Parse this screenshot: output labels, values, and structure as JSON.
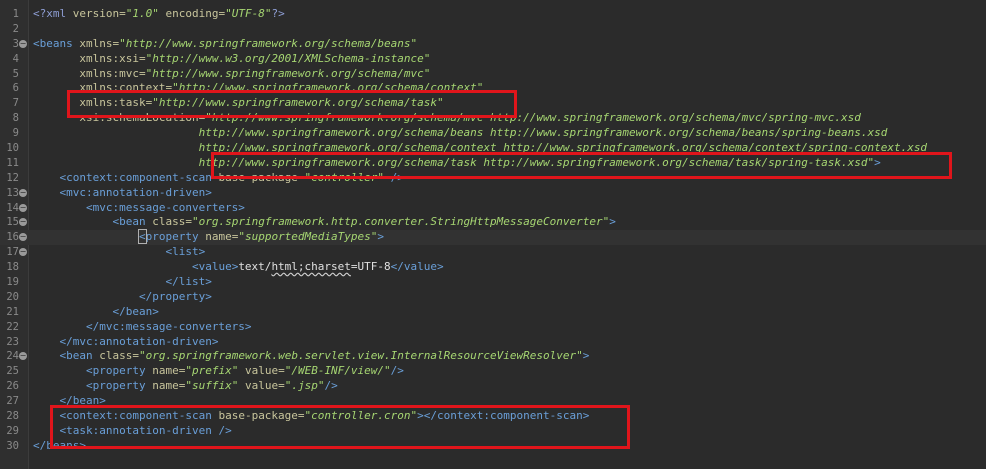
{
  "editor": {
    "highlight_color": "#e0151b",
    "lines": [
      {
        "n": "1",
        "fold": false,
        "indent": 0,
        "tokens": [
          {
            "t": "pi",
            "v": "<?xml "
          },
          {
            "t": "attr",
            "v": "version="
          },
          {
            "t": "val",
            "v": "\"1.0\""
          },
          {
            "t": "plain",
            "v": " "
          },
          {
            "t": "attr",
            "v": "encoding="
          },
          {
            "t": "val",
            "v": "\"UTF-8\""
          },
          {
            "t": "pi",
            "v": "?>"
          }
        ]
      },
      {
        "n": "2",
        "fold": false,
        "indent": 0,
        "tokens": []
      },
      {
        "n": "3",
        "fold": true,
        "indent": 0,
        "tokens": [
          {
            "t": "tag",
            "v": "<beans"
          },
          {
            "t": "plain",
            "v": " "
          },
          {
            "t": "attr",
            "v": "xmlns="
          },
          {
            "t": "val",
            "v": "\"http://www.springframework.org/schema/beans\""
          }
        ]
      },
      {
        "n": "4",
        "fold": false,
        "indent": 0,
        "tokens": [
          {
            "t": "plain",
            "v": "       "
          },
          {
            "t": "attr",
            "v": "xmlns:xsi="
          },
          {
            "t": "val",
            "v": "\"http://www.w3.org/2001/XMLSchema-instance\""
          }
        ]
      },
      {
        "n": "5",
        "fold": false,
        "indent": 0,
        "tokens": [
          {
            "t": "plain",
            "v": "       "
          },
          {
            "t": "attr",
            "v": "xmlns:mvc="
          },
          {
            "t": "val",
            "v": "\"http://www.springframework.org/schema/mvc\""
          }
        ]
      },
      {
        "n": "6",
        "fold": false,
        "indent": 0,
        "tokens": [
          {
            "t": "plain",
            "v": "       "
          },
          {
            "t": "attr",
            "v": "xmlns:context="
          },
          {
            "t": "val",
            "v": "\"http://www.springframework.org/schema/context\""
          }
        ]
      },
      {
        "n": "7",
        "fold": false,
        "indent": 0,
        "tokens": [
          {
            "t": "plain",
            "v": "       "
          },
          {
            "t": "attr",
            "v": "xmlns:task="
          },
          {
            "t": "val",
            "v": "\"http://www.springframework.org/schema/task\""
          }
        ]
      },
      {
        "n": "8",
        "fold": false,
        "indent": 0,
        "tokens": [
          {
            "t": "plain",
            "v": "       "
          },
          {
            "t": "attr",
            "v": "xsi:schemaLocation="
          },
          {
            "t": "val",
            "v": "\"http://www.springframework.org/schema/mvc http://www.springframework.org/schema/mvc/spring-mvc.xsd"
          }
        ]
      },
      {
        "n": "9",
        "fold": false,
        "indent": 0,
        "tokens": [
          {
            "t": "plain",
            "v": "                         "
          },
          {
            "t": "val",
            "v": "http://www.springframework.org/schema/beans http://www.springframework.org/schema/beans/spring-beans.xsd"
          }
        ]
      },
      {
        "n": "10",
        "fold": false,
        "indent": 0,
        "tokens": [
          {
            "t": "plain",
            "v": "                         "
          },
          {
            "t": "val",
            "v": "http://www.springframework.org/schema/context http://www.springframework.org/schema/context/spring-context.xsd"
          }
        ]
      },
      {
        "n": "11",
        "fold": false,
        "indent": 0,
        "tokens": [
          {
            "t": "plain",
            "v": "                         "
          },
          {
            "t": "val",
            "v": "http://www.springframework.org/schema/task http://www.springframework.org/schema/task/spring-task.xsd\""
          },
          {
            "t": "tag",
            "v": ">"
          }
        ]
      },
      {
        "n": "12",
        "fold": false,
        "indent": 0,
        "tokens": [
          {
            "t": "plain",
            "v": "    "
          },
          {
            "t": "tag",
            "v": "<context:component-scan"
          },
          {
            "t": "plain",
            "v": " "
          },
          {
            "t": "attr",
            "v": "base-package="
          },
          {
            "t": "val",
            "v": "\"controller\""
          },
          {
            "t": "tag",
            "v": " />"
          }
        ]
      },
      {
        "n": "13",
        "fold": true,
        "indent": 0,
        "tokens": [
          {
            "t": "plain",
            "v": "    "
          },
          {
            "t": "tag",
            "v": "<mvc:annotation-driven>"
          }
        ]
      },
      {
        "n": "14",
        "fold": true,
        "indent": 0,
        "tokens": [
          {
            "t": "plain",
            "v": "        "
          },
          {
            "t": "tag",
            "v": "<mvc:message-converters>"
          }
        ]
      },
      {
        "n": "15",
        "fold": true,
        "indent": 0,
        "tokens": [
          {
            "t": "plain",
            "v": "            "
          },
          {
            "t": "tag",
            "v": "<bean"
          },
          {
            "t": "plain",
            "v": " "
          },
          {
            "t": "attr",
            "v": "class="
          },
          {
            "t": "val",
            "v": "\"org.springframework.http.converter.StringHttpMessageConverter\""
          },
          {
            "t": "tag",
            "v": ">"
          }
        ]
      },
      {
        "n": "16",
        "fold": true,
        "indent": 0,
        "current": true,
        "tokens": [
          {
            "t": "plain",
            "v": "                "
          },
          {
            "t": "tagbox",
            "v": "<"
          },
          {
            "t": "tag",
            "v": "property"
          },
          {
            "t": "plain",
            "v": " "
          },
          {
            "t": "attr",
            "v": "name="
          },
          {
            "t": "val",
            "v": "\"supportedMediaTypes\""
          },
          {
            "t": "tag",
            "v": ">"
          }
        ]
      },
      {
        "n": "17",
        "fold": true,
        "indent": 0,
        "tokens": [
          {
            "t": "plain",
            "v": "                    "
          },
          {
            "t": "tag",
            "v": "<list>"
          }
        ]
      },
      {
        "n": "18",
        "fold": false,
        "indent": 0,
        "tokens": [
          {
            "t": "plain",
            "v": "                        "
          },
          {
            "t": "tag",
            "v": "<value>"
          },
          {
            "t": "text",
            "v": "text/"
          },
          {
            "t": "err",
            "v": "html;charset"
          },
          {
            "t": "text",
            "v": "=UTF-8"
          },
          {
            "t": "tag",
            "v": "</value>"
          }
        ]
      },
      {
        "n": "19",
        "fold": false,
        "indent": 0,
        "tokens": [
          {
            "t": "plain",
            "v": "                    "
          },
          {
            "t": "tag",
            "v": "</list>"
          }
        ]
      },
      {
        "n": "20",
        "fold": false,
        "indent": 0,
        "tokens": [
          {
            "t": "plain",
            "v": "                "
          },
          {
            "t": "tag",
            "v": "</property>"
          }
        ]
      },
      {
        "n": "21",
        "fold": false,
        "indent": 0,
        "tokens": [
          {
            "t": "plain",
            "v": "            "
          },
          {
            "t": "tag",
            "v": "</bean>"
          }
        ]
      },
      {
        "n": "22",
        "fold": false,
        "indent": 0,
        "tokens": [
          {
            "t": "plain",
            "v": "        "
          },
          {
            "t": "tag",
            "v": "</mvc:message-converters>"
          }
        ]
      },
      {
        "n": "23",
        "fold": false,
        "indent": 0,
        "tokens": [
          {
            "t": "plain",
            "v": "    "
          },
          {
            "t": "tag",
            "v": "</mvc:annotation-driven>"
          }
        ]
      },
      {
        "n": "24",
        "fold": true,
        "indent": 0,
        "tokens": [
          {
            "t": "plain",
            "v": "    "
          },
          {
            "t": "tag",
            "v": "<bean"
          },
          {
            "t": "plain",
            "v": " "
          },
          {
            "t": "attr",
            "v": "class="
          },
          {
            "t": "val",
            "v": "\"org.springframework.web.servlet.view.InternalResourceViewResolver\""
          },
          {
            "t": "tag",
            "v": ">"
          }
        ]
      },
      {
        "n": "25",
        "fold": false,
        "indent": 0,
        "tokens": [
          {
            "t": "plain",
            "v": "        "
          },
          {
            "t": "tag",
            "v": "<property"
          },
          {
            "t": "plain",
            "v": " "
          },
          {
            "t": "attr",
            "v": "name="
          },
          {
            "t": "val",
            "v": "\"prefix\""
          },
          {
            "t": "plain",
            "v": " "
          },
          {
            "t": "attr",
            "v": "value="
          },
          {
            "t": "val",
            "v": "\"/WEB-INF/view/\""
          },
          {
            "t": "tag",
            "v": "/>"
          }
        ]
      },
      {
        "n": "26",
        "fold": false,
        "indent": 0,
        "tokens": [
          {
            "t": "plain",
            "v": "        "
          },
          {
            "t": "tag",
            "v": "<property"
          },
          {
            "t": "plain",
            "v": " "
          },
          {
            "t": "attr",
            "v": "name="
          },
          {
            "t": "val",
            "v": "\"suffix\""
          },
          {
            "t": "plain",
            "v": " "
          },
          {
            "t": "attr",
            "v": "value="
          },
          {
            "t": "val",
            "v": "\".jsp\""
          },
          {
            "t": "tag",
            "v": "/>"
          }
        ]
      },
      {
        "n": "27",
        "fold": false,
        "indent": 0,
        "tokens": [
          {
            "t": "plain",
            "v": "    "
          },
          {
            "t": "tag",
            "v": "</bean>"
          }
        ]
      },
      {
        "n": "28",
        "fold": false,
        "indent": 0,
        "tokens": [
          {
            "t": "plain",
            "v": "    "
          },
          {
            "t": "tag",
            "v": "<context:component-scan"
          },
          {
            "t": "plain",
            "v": " "
          },
          {
            "t": "attr",
            "v": "base-package="
          },
          {
            "t": "val",
            "v": "\"controller.cron\""
          },
          {
            "t": "tag",
            "v": "></context:component-scan>"
          }
        ]
      },
      {
        "n": "29",
        "fold": false,
        "indent": 0,
        "tokens": [
          {
            "t": "plain",
            "v": "    "
          },
          {
            "t": "tag",
            "v": "<task:annotation-driven"
          },
          {
            "t": "plain",
            "v": " "
          },
          {
            "t": "tag",
            "v": "/>"
          }
        ]
      },
      {
        "n": "30",
        "fold": false,
        "indent": 0,
        "tokens": [
          {
            "t": "tag",
            "v": "</beans>"
          }
        ]
      }
    ]
  }
}
